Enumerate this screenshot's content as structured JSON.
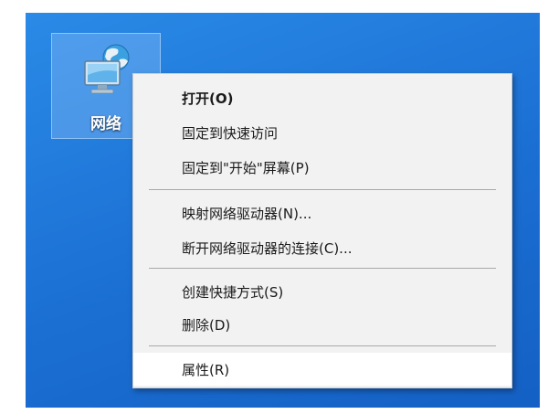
{
  "desktop": {
    "icon_label": "网络",
    "icon_name": "network-icon"
  },
  "context_menu": {
    "items": [
      {
        "label": "打开(O)"
      },
      {
        "label": "固定到快速访问"
      },
      {
        "label": "固定到\"开始\"屏幕(P)"
      },
      {
        "label": "映射网络驱动器(N)..."
      },
      {
        "label": "断开网络驱动器的连接(C)..."
      },
      {
        "label": "创建快捷方式(S)"
      },
      {
        "label": "删除(D)"
      },
      {
        "label": "属性(R)"
      }
    ]
  },
  "colors": {
    "desktop_background": "#1b6fd3",
    "menu_background": "#f2f2f2",
    "menu_highlight": "#ffffff",
    "separator": "#a9a9a9"
  }
}
